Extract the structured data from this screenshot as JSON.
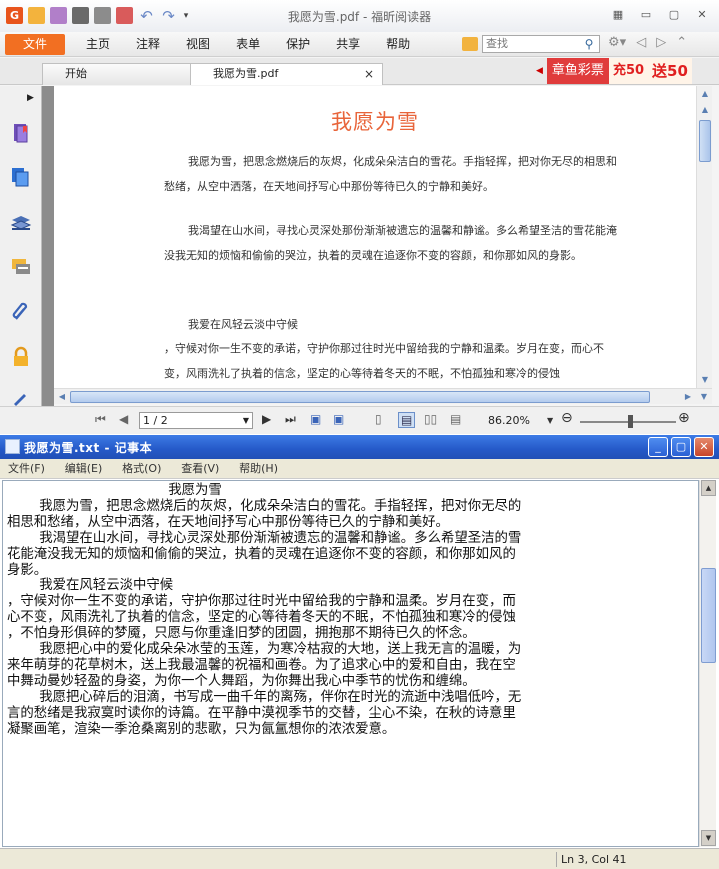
{
  "foxit": {
    "title": "我愿为雪.pdf - 福昕阅读器",
    "menu": [
      "文件",
      "主页",
      "注释",
      "视图",
      "表单",
      "保护",
      "共享",
      "帮助"
    ],
    "search_placeholder": "查找",
    "tabs": [
      {
        "label": "开始"
      },
      {
        "label": "我愿为雪.pdf",
        "close": "×"
      }
    ],
    "ad": {
      "text1": "章鱼彩票",
      "text2": "充50",
      "text3": "送50"
    },
    "document": {
      "title": "我愿为雪",
      "paragraphs": [
        "我愿为雪，把思念燃烧后的灰烬，化成朵朵洁白的雪花。手指轻挥，把对你无尽的相思和愁绪，从空中洒落，在天地间抒写心中那份等待已久的宁静和美好。",
        "我渴望在山水间，寻找心灵深处那份渐渐被遗忘的温馨和静谧。多么希望圣洁的雪花能淹没我无知的烦恼和偷偷的哭泣，执着的灵魂在追逐你不变的容颜，和你那如风的身影。",
        "我爱在风轻云淡中守候",
        "，守候对你一生不变的承诺，守护你那过往时光中留给我的宁静和温柔。岁月在变，而心不变，风雨洗礼了执着的信念，坚定的心等待着冬天的不眠，不怕孤独和寒冷的侵蚀"
      ]
    },
    "status": {
      "page": "1 / 2",
      "zoom": "86.20%"
    }
  },
  "notepad": {
    "title": "我愿为雪.txt - 记事本",
    "menu": [
      "文件(F)",
      "编辑(E)",
      "格式(O)",
      "查看(V)",
      "帮助(H)"
    ],
    "lines": [
      "                    我愿为雪",
      "",
      "    我愿为雪，把思念燃烧后的灰烬，化成朵朵洁白的雪花。手指轻挥，把对你无尽的",
      "相思和愁绪，从空中洒落，在天地间抒写心中那份等待已久的宁静和美好。",
      "",
      "    我渴望在山水间，寻找心灵深处那份渐渐被遗忘的温馨和静谧。多么希望圣洁的雪",
      "花能淹没我无知的烦恼和偷偷的哭泣，执着的灵魂在追逐你不变的容颜，和你那如风的",
      "身影。",
      "",
      "    我爱在风轻云淡中守候",
      "，守候对你一生不变的承诺，守护你那过往时光中留给我的宁静和温柔。岁月在变，而",
      "心不变，风雨洗礼了执着的信念，坚定的心等待着冬天的不眠，不怕孤独和寒冷的侵蚀",
      "，不怕身形俱碎的梦魇，只愿与你重逢旧梦的团圆，拥抱那不期待已久的怀念。",
      "",
      "    我愿把心中的爱化成朵朵冰莹的玉莲，为寒冷枯寂的大地，送上我无言的温暖，为",
      "来年萌芽的花草树木，送上我最温馨的祝福和画卷。为了追求心中的爱和自由，我在空",
      "中舞动曼妙轻盈的身姿，为你一个人舞蹈，为你舞出我心中季节的忧伤和缠绵。",
      "",
      "    我愿把心碎后的泪滴，书写成一曲千年的离殇，伴你在时光的流逝中浅唱低吟，无",
      "言的愁绪是我寂寞时读你的诗篇。在平静中漠视季节的交替，尘心不染，在秋的诗意里",
      "凝聚画笔，渲染一季沧桑离别的悲歌，只为氤氲想你的浓浓爱意。"
    ],
    "status": "Ln 3, Col 41"
  }
}
